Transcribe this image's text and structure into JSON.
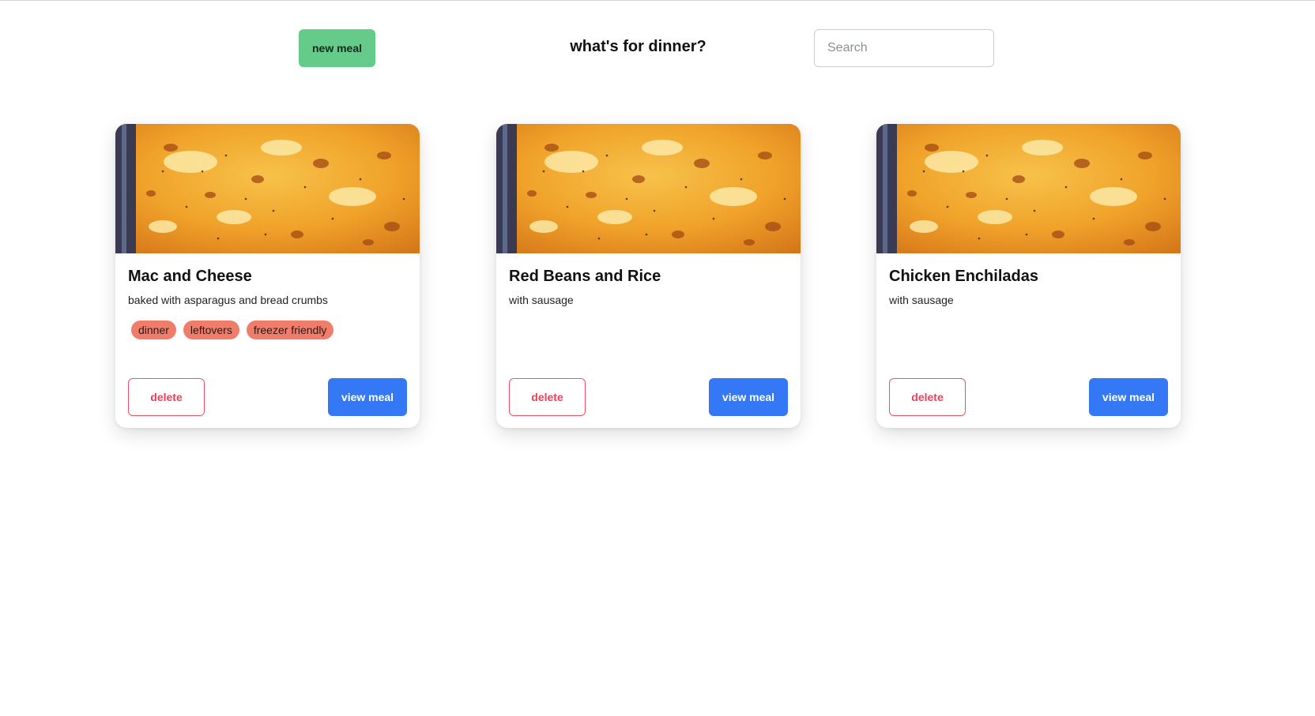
{
  "header": {
    "new_meal_label": "new meal",
    "title": "what's for dinner?",
    "search_placeholder": "Search",
    "search_value": ""
  },
  "meals": [
    {
      "title": "Mac and Cheese",
      "description": "baked with asparagus and bread crumbs",
      "tags": [
        "dinner",
        "leftovers",
        "freezer friendly"
      ],
      "delete_label": "delete",
      "view_label": "view meal"
    },
    {
      "title": "Red Beans and Rice",
      "description": "with sausage",
      "tags": [],
      "delete_label": "delete",
      "view_label": "view meal"
    },
    {
      "title": "Chicken Enchiladas",
      "description": "with sausage",
      "tags": [],
      "delete_label": "delete",
      "view_label": "view meal"
    }
  ],
  "colors": {
    "new_meal_button": "#65cb8a",
    "tag": "#f07c6a",
    "delete_border": "#f25067",
    "view_button": "#3478f6"
  }
}
